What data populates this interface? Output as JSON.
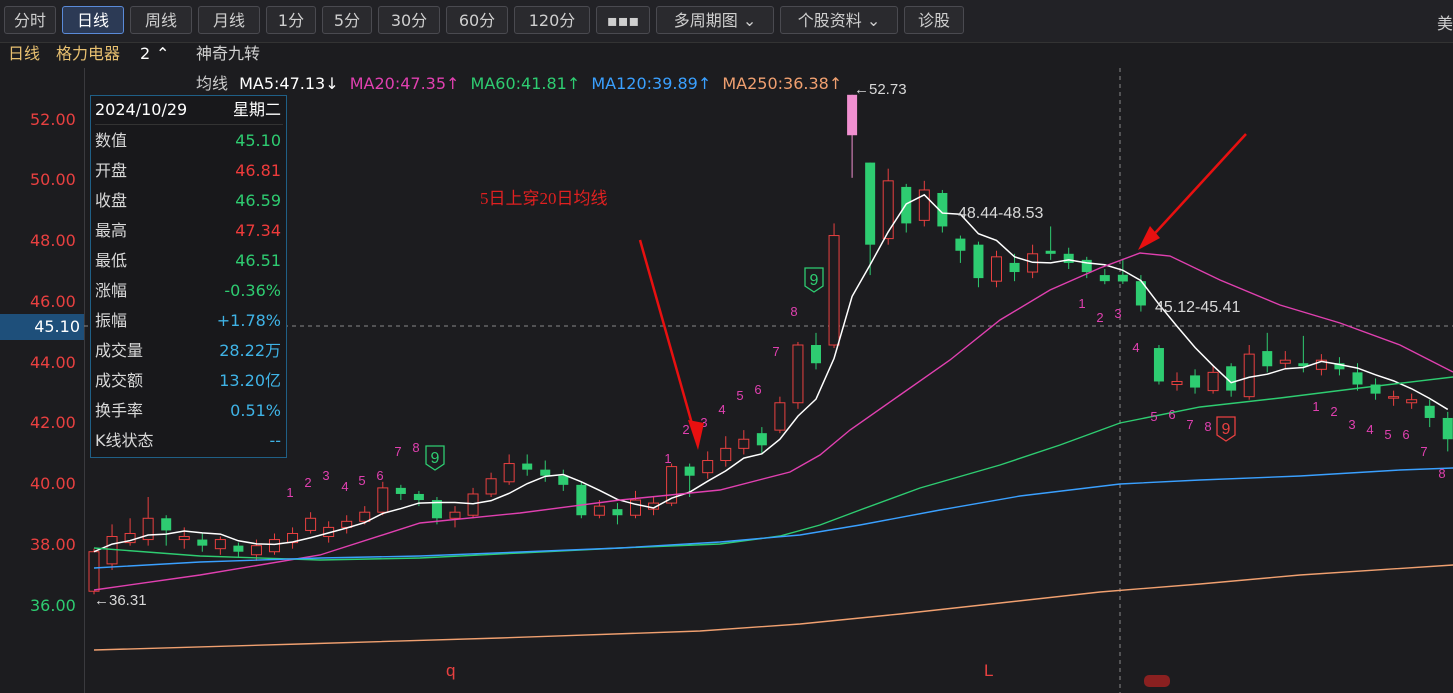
{
  "toolbar": {
    "buttons": [
      "分时",
      "日线",
      "周线",
      "月线",
      "1分",
      "5分",
      "30分",
      "60分",
      "120分",
      "▪▪▪",
      "多周期图 ⌄",
      "个股资料 ⌄",
      "诊股"
    ],
    "active_index": 1,
    "right_text": "美"
  },
  "infobar": {
    "period": "日线",
    "stock_name": "格力电器",
    "count": "2",
    "indicator": "神奇九转"
  },
  "ma_bar": {
    "label": "均线",
    "items": [
      {
        "text": "MA5:47.13↓",
        "color": "#ffffff"
      },
      {
        "text": "MA20:47.35↑",
        "color": "#e040b0"
      },
      {
        "text": "MA60:41.81↑",
        "color": "#2ecc71"
      },
      {
        "text": "MA120:39.89↑",
        "color": "#3aa0ff"
      },
      {
        "text": "MA250:36.38↑",
        "color": "#f0a070"
      }
    ]
  },
  "yaxis": {
    "labels": [
      "52.00",
      "50.00",
      "48.00",
      "46.00",
      "44.00",
      "42.00",
      "40.00",
      "38.00",
      "36.00"
    ],
    "current_price": "45.10"
  },
  "data_panel": {
    "date": "2024/10/29",
    "weekday": "星期二",
    "rows": [
      {
        "k": "数值",
        "v": "45.10",
        "c": "green"
      },
      {
        "k": "开盘",
        "v": "46.81",
        "c": "red"
      },
      {
        "k": "收盘",
        "v": "46.59",
        "c": "green"
      },
      {
        "k": "最高",
        "v": "47.34",
        "c": "red"
      },
      {
        "k": "最低",
        "v": "46.51",
        "c": "green"
      },
      {
        "k": "涨幅",
        "v": "-0.36%",
        "c": "green"
      },
      {
        "k": "振幅",
        "v": "+1.78%",
        "c": "cyan"
      },
      {
        "k": "成交量",
        "v": "28.22万",
        "c": "cyan"
      },
      {
        "k": "成交额",
        "v": "13.20亿",
        "c": "cyan"
      },
      {
        "k": "换手率",
        "v": "0.51%",
        "c": "cyan"
      },
      {
        "k": "K线状态",
        "v": "--",
        "c": "cyan"
      }
    ]
  },
  "annotations": {
    "cross_text": "5日上穿20日均线",
    "high_mark": "←52.73",
    "low_mark": "←36.31",
    "range1": "48.44-48.53",
    "range2": "45.12-45.41",
    "bottom_q": "q",
    "bottom_l": "L"
  },
  "colors": {
    "up": "#e84040",
    "down": "#2ecc71",
    "ma5": "#ffffff",
    "ma20": "#e040b0",
    "ma60": "#2ecc71",
    "ma120": "#3aa0ff",
    "ma250": "#f0a070",
    "nine": "#e040b0"
  }
}
